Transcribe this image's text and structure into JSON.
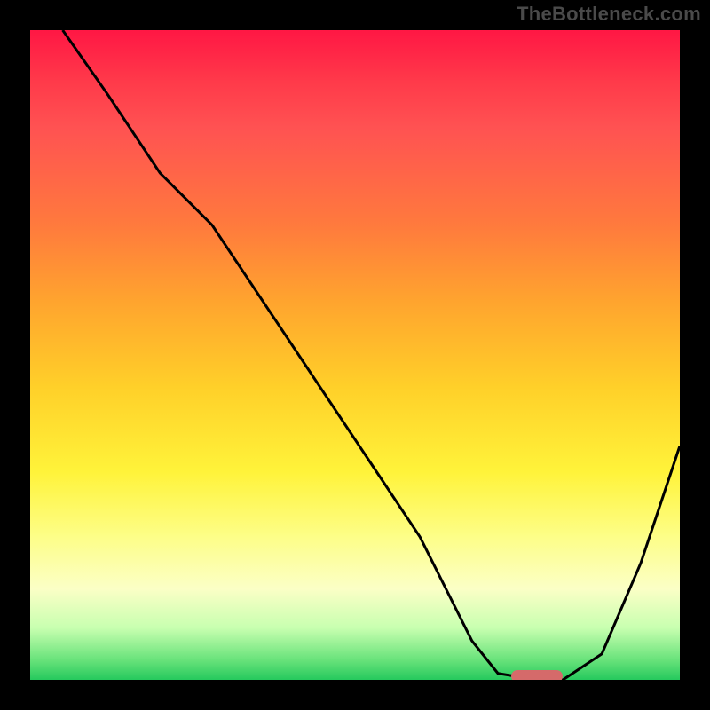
{
  "attribution": "TheBottleneck.com",
  "colors": {
    "curve_stroke": "#000000",
    "pill_fill": "#d56a6a",
    "border": "#000000",
    "gradient_top": "#ff1744",
    "gradient_bottom": "#25c95d"
  },
  "chart_data": {
    "type": "line",
    "title": "",
    "xlabel": "",
    "ylabel": "",
    "xlim": [
      0,
      100
    ],
    "ylim": [
      0,
      100
    ],
    "series": [
      {
        "name": "bottleneck-curve",
        "x": [
          5,
          12,
          20,
          28,
          36,
          44,
          52,
          60,
          68,
          72,
          78,
          82,
          88,
          94,
          100
        ],
        "y": [
          100,
          90,
          78,
          70,
          58,
          46,
          34,
          22,
          6,
          1,
          0,
          0,
          4,
          18,
          36
        ]
      }
    ],
    "highlight": {
      "name": "optimal-band",
      "x_range": [
        74,
        82
      ],
      "y": 0
    },
    "background_scale": {
      "description": "vertical gradient red→yellow→green denoting bottleneck severity (green = optimal)",
      "stops": [
        {
          "pos": 0.0,
          "color": "#ff1744"
        },
        {
          "pos": 0.55,
          "color": "#ffd029"
        },
        {
          "pos": 0.86,
          "color": "#fbffc6"
        },
        {
          "pos": 1.0,
          "color": "#25c95d"
        }
      ]
    }
  }
}
